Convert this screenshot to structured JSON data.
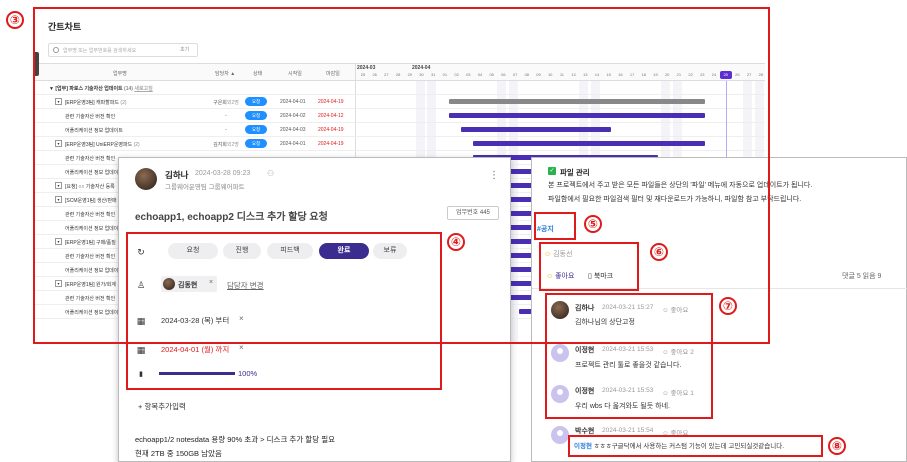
{
  "gantt": {
    "title": "간트차트",
    "search_placeholder": "업무명 또는 업무번호를 검색하세요",
    "reset": "초기",
    "col_task": "업무명",
    "col_owner": "담당자 ▲",
    "col_status": "상태",
    "col_start": "시작일",
    "col_end": "마감일",
    "month1": "2024-03",
    "month2": "2024-04",
    "days": [
      "25",
      "26",
      "27",
      "28",
      "29",
      "30",
      "31",
      "01",
      "02",
      "03",
      "04",
      "05",
      "06",
      "07",
      "08",
      "09",
      "10",
      "11",
      "12",
      "13",
      "14",
      "15",
      "16",
      "17",
      "18",
      "19",
      "20",
      "21",
      "22",
      "23",
      "24",
      "25",
      "26",
      "27",
      "28"
    ],
    "today": "22",
    "group": {
      "label": "[업무] 파로스 기술자산 업데이트",
      "count": "(14)",
      "link": "새로고침"
    },
    "rows": [
      {
        "name": "[ERP운영3팀] 캐파할파드",
        "sub": "(2)",
        "owner": "구은희",
        "owner_sub": "외2명",
        "status": "요청",
        "start": "2024-04-01",
        "end": "2024-04-19"
      },
      {
        "name": "관련 기술자산 버전 확인",
        "owner": "-",
        "status": "요청",
        "start": "2024-04-02",
        "end": "2024-04-12"
      },
      {
        "name": "어플리케이션 정보 업데이트",
        "owner": "-",
        "status": "요청",
        "start": "2024-04-03",
        "end": "2024-04-19"
      },
      {
        "name": "[ERP운영3팀] UniERP운영파드",
        "sub": "(2)",
        "owner": "김지희",
        "owner_sub": "외2명",
        "status": "요청",
        "start": "2024-04-01",
        "end": "2024-04-19"
      },
      {
        "name": "관련 기술자산 버전 확인"
      },
      {
        "name": "어플리케이션 정보 업데이트"
      },
      {
        "name": "[요청] ○○ 기술자산 등록"
      },
      {
        "name": "[SCM운영1팀] 생산/판매"
      },
      {
        "name": "관련 기술자산 버전 확인"
      },
      {
        "name": "어플리케이션 정보 업데이트"
      },
      {
        "name": "[ERP운영1팀] 구매/품질"
      },
      {
        "name": "관련 기술자산 버전 확인"
      },
      {
        "name": "어플리케이션 정보 업데이트"
      },
      {
        "name": "[ERP운영1팀] 원가/회계"
      },
      {
        "name": "관련 기술자산 버전 확인"
      },
      {
        "name": "어플리케이션 정보 업데이트"
      }
    ]
  },
  "cardL": {
    "author": "김하나",
    "time": "2024-03-28 09:23",
    "dept": "그룹웨어운영팀 그룹웨어파트",
    "title": "echoapp1, echoapp2 디스크 추가 할당 요청",
    "task_no": "업무번호 445",
    "statuses": [
      "요청",
      "진행",
      "피드백",
      "완료",
      "보류"
    ],
    "assignee": "김동현",
    "change_assignee": "담당자 변경",
    "start": "2024-03-28 (목) 부터",
    "end": "2024-04-01 (월) 까지",
    "progress": "100%",
    "progress_value": 100,
    "add_item": "항목추가입력",
    "body1": "echoapp1/2 notesdata 용량 90% 초과 > 디스크 추가 할당 필요",
    "body2": "현재 2TB 중 150GB 남았음"
  },
  "cardR": {
    "section": "파일 관리",
    "line1": "본 프로젝트에서 주고 받은 모든 파일들은 상단의 '파일' 메뉴에 자동으로 업데이트가 됩니다.",
    "line2": "파일함에서 필요한 파일검색 필터 및 재다운로드가 가능하니, 파일함 참고 부탁드립니다.",
    "tag": "#공지",
    "like_user": "김동선",
    "like": "좋아요",
    "bookmark": "북마크",
    "stats": "댓글 5  읽음 9",
    "comments": [
      {
        "name": "김하나",
        "time": "2024-03-21 15:27",
        "likes": "☺ 좋아요",
        "text": "김하나님의 상단고정"
      },
      {
        "name": "이정현",
        "time": "2024-03-21 15:53",
        "likes": "☺ 좋아요 2",
        "text": "프로젝트 관리 툴로 좋을것 같습니다."
      },
      {
        "name": "이정현",
        "time": "2024-03-21 15:53",
        "likes": "☺ 좋아요 1",
        "text": "우리 wbs 다 옮겨와도 될듯 하네."
      },
      {
        "name": "박수현",
        "time": "2024-03-21 15:54",
        "likes": "☺ 좋아요",
        "text": ""
      }
    ],
    "mention_name": "이정현",
    "mention_text": "ㅎㅎㅎ구글닥에서 사용하는 커스텀 기능이 있는데 고민되실것같습니다."
  },
  "markers": [
    "③",
    "④",
    "⑤",
    "⑥",
    "⑦",
    "⑧"
  ],
  "colors": {
    "accent": "#3b2c8f",
    "bar": "#4a2fb4",
    "status": "#1e90ff",
    "red": "#e01a1a"
  }
}
